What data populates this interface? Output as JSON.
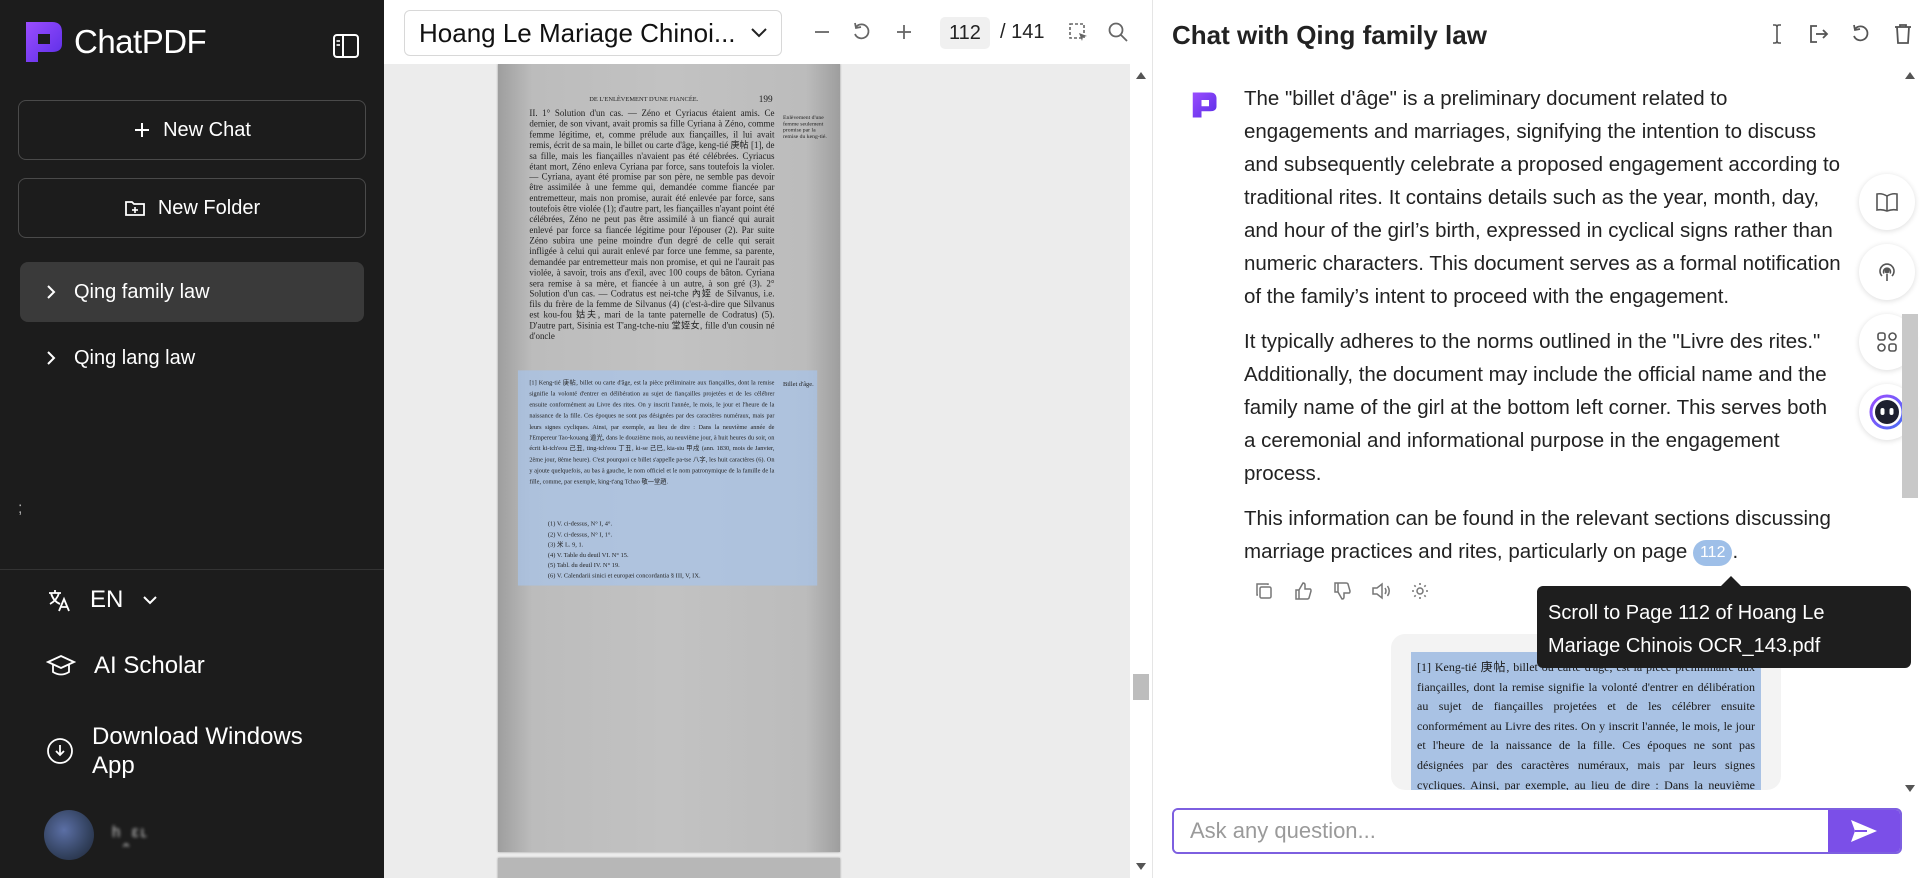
{
  "app": {
    "name": "ChatPDF"
  },
  "sidebar": {
    "new_chat": "New Chat",
    "new_folder": "New Folder",
    "folders": [
      {
        "label": "Qing family law",
        "active": true
      },
      {
        "label": "Qing lang law",
        "active": false
      }
    ],
    "stray_mark": ";",
    "language": "EN",
    "ai_scholar": "AI Scholar",
    "download_line1": "Download Windows",
    "download_line2": "App",
    "username": "ʰꞈᵋᶫ"
  },
  "viewer": {
    "document_title": "Hoang Le Mariage Chinoi...",
    "current_page": "112",
    "page_total": "/ 141",
    "page": {
      "header": "DE L'ENLÈVEMENT D'UNE FIANCÉE.",
      "number": "199",
      "margin_note": "Enlèvement d'une femme seulement promise par la remise du keng-tié.",
      "body": "II. 1° Solution d'un cas. — Zéno et Cyriacus étaient amis. Ce dernier, de son vivant, avait promis sa fille Cyriana à Zéno, comme femme légitime, et, comme prélude aux fiançailles, il lui avait remis, écrit de sa main, le billet ou carte d'âge, keng-tié 庚帖 [1], de sa fille, mais les fiançailles n'avaient pas été célébrées. Cyriacus étant mort, Zéno enleva Cyriana par force, sans toutefois la violer. — Cyriana, ayant été promise par son père, ne semble pas devoir être assimilée à une femme qui, demandée comme fiancée par entremetteur, mais non promise, aurait été enlevée par force, sans toutefois être violée (1); d'autre part, les fiançailles n'ayant point été célébrées, Zéno ne peut pas être assimilé à un fiancé qui aurait enlevé par force sa fiancée légitime pour l'épouser (2). Par suite Zéno subira une peine moindre d'un degré de celle qui serait infligée à celui qui aurait enlevé par force une femme, sa parente, demandée par entremetteur mais non promise, et qui ne l'aurait pas violée, à savoir, trois ans d'exil, avec 100 coups de bâton. Cyriana sera remise à sa mère, et fiancée à un autre, à son gré (3). 2° Solution d'un cas. — Codratus est nei-tche 內姪 de Silvanus, i.e. fils du frère de la femme de Silvanus (4) (c'est-à-dire que Silvanus est kou-fou 姑夫, mari de la tante paternelle de Codratus) (5). D'autre part, Sisinia est T'ang-tche-niu 堂姪女, fille d'un cousin né d'oncle",
      "footnote_margin": "Billet d'âge.",
      "footnote": "[1] Keng-tié 庚帖, billet ou carte d'âge, est la pièce préliminaire aux fiançailles, dont la remise signifie la volonté d'entrer en délibération au sujet de fiançailles projetées et de les célébrer ensuite conformément au Livre des rites. On y inscrit l'année, le mois, le jour et l'heure de la naissance de la fille. Ces époques ne sont pas désignées par des caractères numéraux, mais par leurs signes cycliques. Ainsi, par exemple, au lieu de dire : Dans la neuvième année de l'Empereur Tao-kouang 道光, dans le douzième mois, au neuvième jour, à huit heures du soir, on écrit ki-tch'eou 己丑, ting-tch'eou 丁丑, ki-se 己巳, kia-siu 甲戌 (ann. 1830, mois de Janvier, 2ème jour, 8ème heure). C'est pourquoi ce billet s'appelle pa-tse 八字, les huit caractères (6). On y ajoute quelquefois, au bas à gauche, le nom officiel et le nom patronymique de la famille de la fille, comme, par exemple, king-t'ang Tchao 敬一堂趙.",
      "refs": [
        "(1) V. ci-dessus, N° I, 4°.",
        "(2) V. ci-dessus, N° I, 1°.",
        "(3) 米 L. 9, 1.",
        "(4) V. Table du deuil VI. N° 15.",
        "(5) Tabl. du deuil IV. N° 19.",
        "(6) V. Calendarii sinici et europæi concordantia § III, V, IX."
      ]
    }
  },
  "chat": {
    "title": "Chat with Qing family law",
    "message_p1": "The \"billet d'âge\" is a preliminary document related to engagements and marriages, signifying the intention to discuss and subsequently celebrate a proposed engagement according to traditional rites. It contains details such as the year, month, day, and hour of the girl’s birth, expressed in cyclical signs rather than numeric characters. This document serves as a formal notification of the family’s intent to proceed with the engagement.",
    "message_p2": "It typically adheres to the norms outlined in the \"Livre des rites.\" Additionally, the document may include the official name and the family name of the girl at the bottom left corner. This serves both a ceremonial and informational purpose in the engagement process.",
    "message_p3": "This information can be found in the relevant sections discussing marriage practices and rites, particularly on page",
    "page_ref": "112",
    "period": ".",
    "tooltip": "Scroll to Page 112 of Hoang Le Mariage Chinois OCR_143.pdf",
    "snippet_text": "[1] Keng-tié 庚帖, billet ou carte d'âge, est la pièce préliminaire aux fiançailles, dont la remise signifie la volonté d'entrer en délibération au sujet de fiançailles projetées et de les célébrer ensuite conformément au Livre des rites. On y inscrit l'année, le mois, le jour et l'heure de la naissance de la fille. Ces époques ne sont pas désignées par des caractères numéraux, mais par leurs signes cycliques. Ainsi, par exemple, au lieu de dire : Dans la neuvième année de l'Empereur Tao-kouang 道光, dans le douzième mois, au neuvième jour, à huit heures du soir, on écrit ki-tch'eou",
    "input_placeholder": "Ask any question..."
  },
  "colors": {
    "sidebar_bg": "#1c1c1c",
    "brand_gradient_start": "#8b3dff",
    "brand_gradient_end": "#5d2be0",
    "accent": "#7b4fe8",
    "highlight": "#a7c4ec",
    "page_chip": "#9ebfe8"
  },
  "icons": {
    "sidebar_toggle": "sidebar-toggle-icon",
    "plus": "plus-icon",
    "folder": "folder-plus-icon",
    "chevron": "chevron-right-icon",
    "language": "translate-icon",
    "scholar": "graduation-cap-icon",
    "download": "download-circle-icon"
  }
}
